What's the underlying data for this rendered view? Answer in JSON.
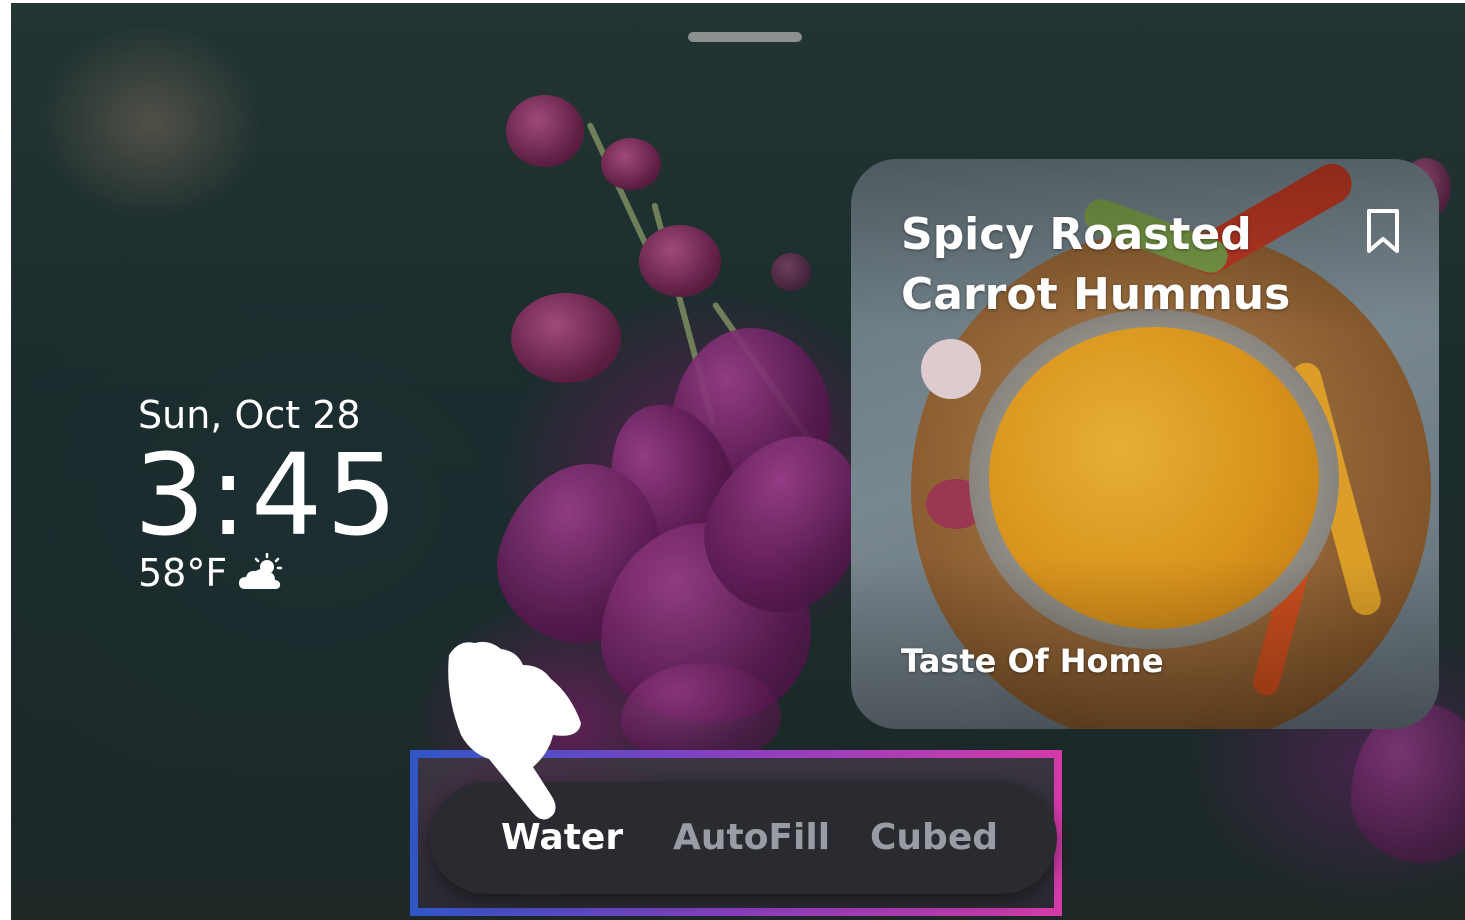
{
  "clock": {
    "date": "Sun, Oct 28",
    "time": "3:45",
    "temperature": "58°F",
    "weather_icon": "partly-sunny-icon"
  },
  "recipe_card": {
    "title": "Spicy Roasted Carrot Hummus",
    "source": "Taste Of Home",
    "bookmark_icon": "bookmark-icon"
  },
  "tabs": {
    "items": [
      {
        "label": "Water",
        "active": true
      },
      {
        "label": "AutoFill",
        "active": false
      },
      {
        "label": "Cubed",
        "active": false
      }
    ]
  },
  "colors": {
    "highlight_start": "#2f56c8",
    "highlight_mid": "#8b3fc2",
    "highlight_end": "#d43aa8",
    "tab_bar": "#2a2b30",
    "tab_active": "#ffffff",
    "tab_inactive": "#9a9ca3"
  }
}
